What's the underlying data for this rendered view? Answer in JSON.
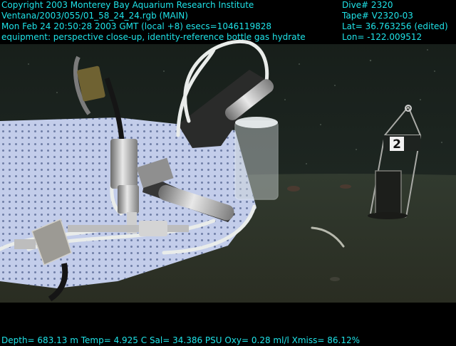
{
  "overlay": {
    "top_left": [
      "Copyright 2003 Monterey Bay Aquarium Research Institute",
      "Ventana/2003/055/01_58_24_24.rgb (MAIN)",
      "Mon Feb 24 20:50:28 2003 GMT (local +8)  esecs=1046119828",
      "equipment: perspective close-up, identity-reference bottle gas hydrate"
    ],
    "top_right": [
      "Dive# 2320",
      "Tape# V2320-03",
      "Lat= 36.763256 (edited)",
      "Lon= -122.009512"
    ],
    "bottom": "Depth= 683.13 m  Temp= 4.925 C  Sal= 34.386 PSU  Oxy= 0.28 ml/l  Xmiss= 86.12%",
    "marker_label": "2"
  },
  "colors": {
    "overlay_text": "#1fe3e8",
    "water": "#1c2620",
    "seafloor": "#2e3327",
    "panel": "#c3cdea"
  }
}
